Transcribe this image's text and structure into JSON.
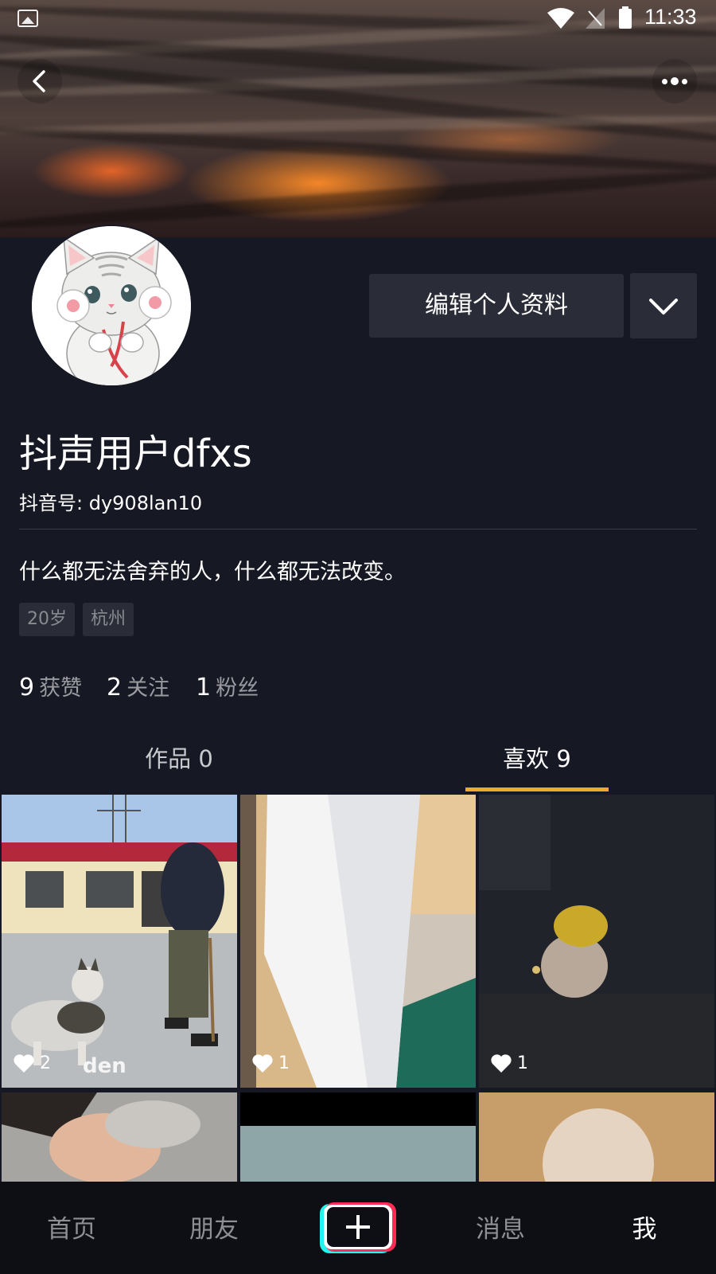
{
  "status_bar": {
    "time": "11:33"
  },
  "profile": {
    "edit_button": "编辑个人资料",
    "nickname": "抖声用户dfxs",
    "douyin_id": "抖音号: dy908lan10",
    "signature": "什么都无法舍弃的人，什么都无法改变。",
    "tags": [
      "20岁",
      "杭州"
    ]
  },
  "stats": [
    {
      "value": "9",
      "label": "获赞"
    },
    {
      "value": "2",
      "label": "关注"
    },
    {
      "value": "1",
      "label": "粉丝"
    }
  ],
  "tabs": {
    "works": "作品 0",
    "likes": "喜欢 9",
    "active": "likes"
  },
  "videos": [
    {
      "likes": "2",
      "watermark": "den"
    },
    {
      "likes": "1"
    },
    {
      "likes": "1"
    }
  ],
  "bottom_nav": {
    "home": "首页",
    "friends": "朋友",
    "messages": "消息",
    "me": "我",
    "active": "me"
  },
  "colors": {
    "background": "#161823",
    "tab_indicator": "#f1a72e",
    "button_bg": "#2a2c37",
    "plus_left_accent": "#25f4ee",
    "plus_right_accent": "#fe2c55"
  }
}
